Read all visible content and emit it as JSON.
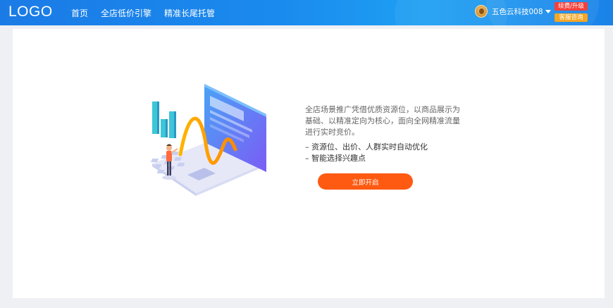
{
  "header": {
    "logo": "LOGO",
    "nav": [
      {
        "label": "首页"
      },
      {
        "label": "全店低价引擎"
      },
      {
        "label": "精准长尾托管"
      }
    ],
    "user": {
      "name": "五色云科技008",
      "avatar_icon": "user-avatar-icon"
    },
    "renew_label": "续费/升级",
    "service_label": "客服咨询"
  },
  "main": {
    "description": "全店场景推广凭借优质资源位，以商品展示为基础、以精准定向为核心，面向全网精准流量进行实时竞价。",
    "bullets": [
      "– 资源位、出价、人群实时自动优化",
      "– 智能选择兴趣点"
    ],
    "cta_label": "立即开启"
  },
  "colors": {
    "header_start": "#1b7be6",
    "header_end": "#1ea0f3",
    "cta": "#ff5a12",
    "renew_badge": "#f5403a",
    "service_badge": "#f5a623",
    "page_bg": "#eef0f4"
  }
}
